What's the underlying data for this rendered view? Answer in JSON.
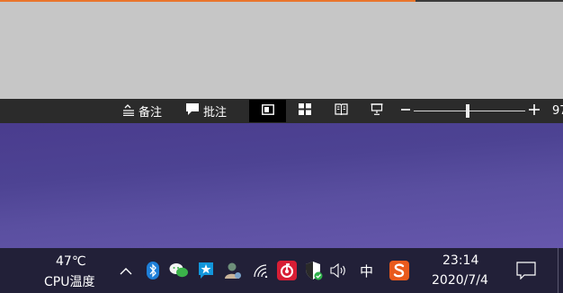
{
  "statusbar": {
    "notes_label": "备注",
    "comments_label": "批注",
    "zoom_level": "97",
    "zoom_fraction": 0.48
  },
  "taskbar": {
    "temperature": "47℃",
    "temperature_label": "CPU温度",
    "ime_label": "中",
    "time": "23:14",
    "date": "2020/7/4"
  },
  "colors": {
    "accent": "#e9752c",
    "statusbar_bg": "#2b2b2b",
    "taskbar_bg": "#222038",
    "desktop": "#4d4393"
  },
  "icons": {
    "notes": "notes-icon",
    "comments": "comment-icon",
    "normal_view": "normal-view-icon",
    "slide_sorter": "slide-sorter-icon",
    "reading_view": "reading-view-icon",
    "slideshow": "slideshow-icon",
    "tray": [
      "chevron-up-icon",
      "bluetooth-icon",
      "wechat-icon",
      "tim-icon",
      "user-app-icon",
      "wifi-icon",
      "netease-music-icon",
      "security-shield-icon",
      "volume-icon",
      "sogou-ime-icon",
      "notification-icon"
    ]
  }
}
